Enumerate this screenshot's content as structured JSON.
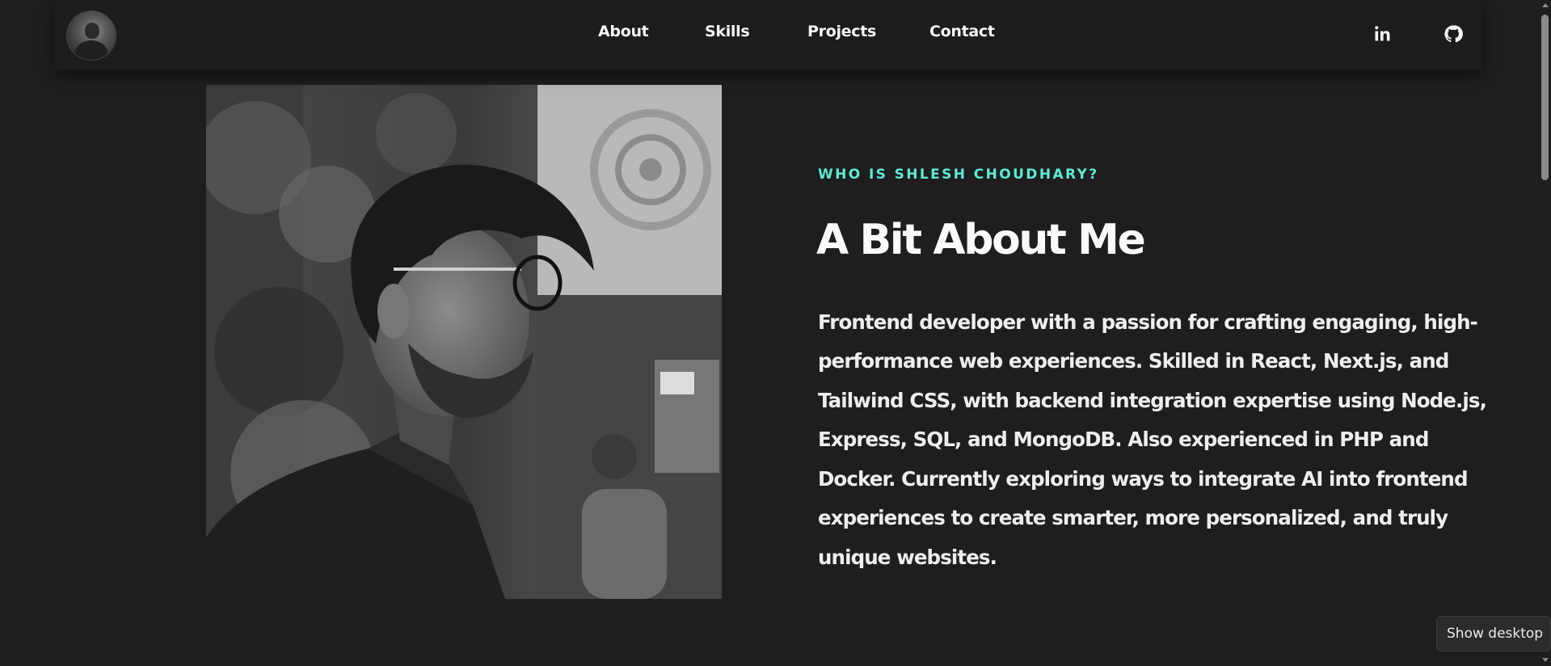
{
  "nav": {
    "avatar_alt": "profile avatar",
    "links": [
      {
        "label": "About"
      },
      {
        "label": "Skills"
      },
      {
        "label": "Projects"
      },
      {
        "label": "Contact"
      }
    ],
    "social": [
      {
        "icon": "linkedin-icon"
      },
      {
        "icon": "github-icon"
      }
    ]
  },
  "about": {
    "eyebrow": "WHO IS SHLESH CHOUDHARY?",
    "heading": "A Bit About Me",
    "bio": "Frontend developer with a passion for crafting engaging, high-performance web experiences. Skilled in React, Next.js, and Tailwind CSS, with backend integration expertise using Node.js, Express, SQL, and MongoDB. Also experienced in PHP and Docker. Currently exploring ways to integrate AI into frontend experiences to create smarter, more personalized, and truly unique websites."
  },
  "tooltip": {
    "text": "Show desktop"
  },
  "colors": {
    "background": "#1e1e1e",
    "navbar": "#1c1c1c",
    "accent": "#5eead4",
    "text": "#f2f2f2"
  }
}
